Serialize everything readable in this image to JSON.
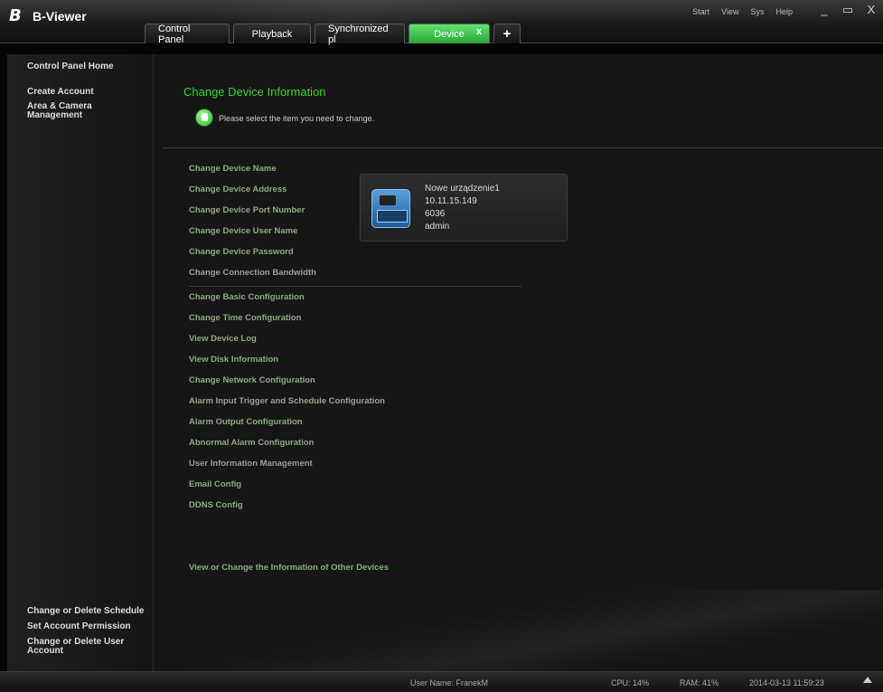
{
  "app": {
    "title": "B-Viewer",
    "logo_letter": "B"
  },
  "top_menu": [
    "Start",
    "View",
    "Sys",
    "Help"
  ],
  "window_controls": {
    "minimize": "_",
    "restore": "▭",
    "close": "X"
  },
  "tabs": [
    {
      "label": "Control Panel"
    },
    {
      "label": "Playback"
    },
    {
      "label": "Synchronized pl"
    },
    {
      "label": "Device",
      "close": "x",
      "active": true
    }
  ],
  "add_tab_label": "+",
  "sidebar": {
    "top_items": [
      "Control Panel Home",
      "Create Account",
      "Area & Camera\nManagement"
    ],
    "bottom_items": [
      "Change or Delete Schedule",
      "Set Account Permission",
      "Change or Delete User\nAccount"
    ]
  },
  "main": {
    "heading": "Change Device Information",
    "hint": "Please select the item you need to change.",
    "links_group1": [
      "Change Device Name",
      "Change Device Address",
      "Change Device Port Number",
      "Change Device User Name",
      "Change Device Password",
      "Change Connection Bandwidth"
    ],
    "links_group2": [
      "Change Basic Configuration",
      "Change Time Configuration",
      "View Device Log",
      "View Disk Information",
      "Change Network Configuration",
      "Alarm Input Trigger and Schedule Configuration",
      "Alarm Output Configuration",
      "Abnormal Alarm Configuration",
      "User Information Management",
      "Email Config",
      "DDNS Config"
    ],
    "other_devices_link": "View or Change the Information of Other Devices",
    "device_card": {
      "name": "Nowe urządzenie1",
      "address": "10.11.15.149",
      "port": "6036",
      "user": "admin"
    }
  },
  "status": {
    "user": "User Name: FranekM",
    "cpu": "CPU: 14%",
    "ram": "RAM: 41%",
    "datetime": "2014-03-13 11:59:23"
  },
  "colors": {
    "accent_green": "#37d52f",
    "link_green": "#8bab83",
    "active_tab": "#3fbf4a"
  }
}
